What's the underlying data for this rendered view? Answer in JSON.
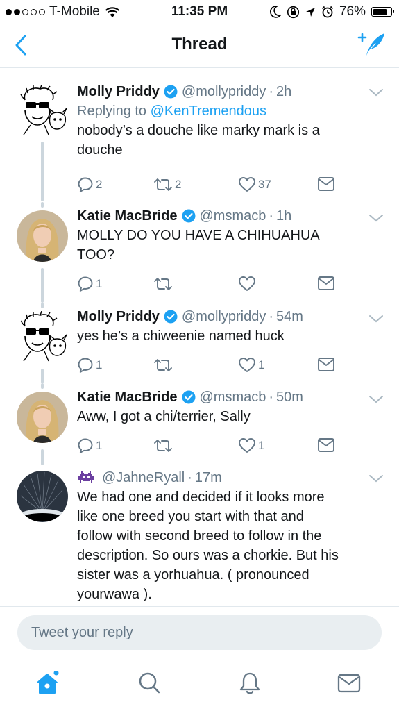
{
  "status_bar": {
    "carrier": "T-Mobile",
    "signal_dots_filled": 2,
    "signal_dots_total": 5,
    "time": "11:35 PM",
    "battery": "76%",
    "battery_level": 0.76
  },
  "nav": {
    "title": "Thread",
    "back_icon": "chevron-left-icon",
    "compose_icon": "compose-tweet-icon"
  },
  "colors": {
    "accent": "#1da1f2",
    "text": "#14171a",
    "muted": "#657786",
    "divider": "#e1e8ed"
  },
  "tweets": [
    {
      "name": "Molly Priddy",
      "verified": true,
      "handle": "@mollypriddy",
      "time": "2h",
      "reply_prefix": "Replying to",
      "reply_to": "@KenTremendous",
      "lines": [
        "nobody’s a douche like marky mark is a",
        "douche"
      ],
      "replies": "2",
      "retweets": "2",
      "likes": "37"
    },
    {
      "name": "Katie MacBride",
      "verified": true,
      "handle": "@msmacb",
      "time": "1h",
      "lines": [
        "MOLLY DO YOU HAVE A CHIHUAHUA",
        "TOO?"
      ],
      "replies": "1",
      "retweets": "",
      "likes": ""
    },
    {
      "name": "Molly Priddy",
      "verified": true,
      "handle": "@mollypriddy",
      "time": "54m",
      "lines": [
        "yes he’s a chiweenie named huck"
      ],
      "replies": "1",
      "retweets": "",
      "likes": "1"
    },
    {
      "name": "Katie MacBride",
      "verified": true,
      "handle": "@msmacb",
      "time": "50m",
      "lines": [
        "Aww, I got a chi/terrier, Sally"
      ],
      "replies": "1",
      "retweets": "",
      "likes": "1"
    },
    {
      "name": "",
      "name_icon": "space-invader-icon",
      "verified": false,
      "handle": "@JahneRyall",
      "time": "17m",
      "lines": [
        "We had one and decided if it looks more",
        "like one breed you start with that and",
        "follow with second breed to follow in the",
        "description.  So ours was a chorkie. But his",
        "sister was a yorhuahua. ( pronounced",
        "yourwawa )."
      ]
    }
  ],
  "reply_box": {
    "placeholder": "Tweet your reply"
  },
  "tab_bar": {
    "items": [
      "home-icon",
      "search-icon",
      "notifications-icon",
      "messages-icon"
    ],
    "home_has_new_dot": true
  }
}
